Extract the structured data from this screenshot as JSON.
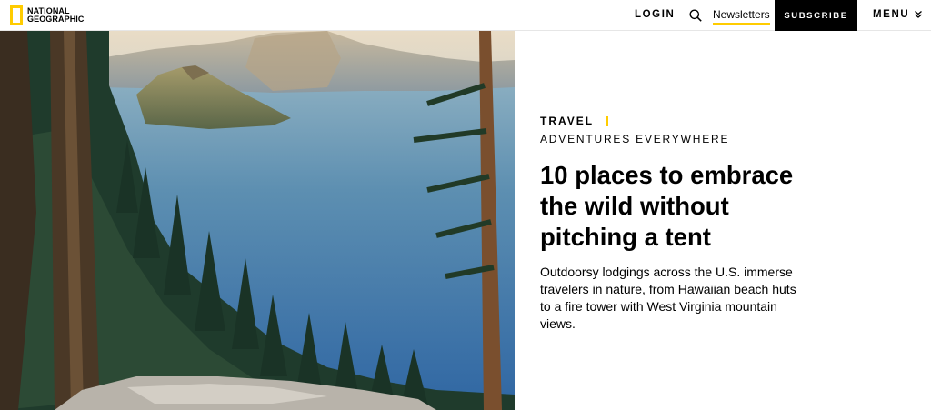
{
  "header": {
    "logo_line1": "NATIONAL",
    "logo_line2": "GEOGRAPHIC",
    "login_label": "LOGIN",
    "newsletters_label": "Newsletters",
    "subscribe_label": "SUBSCRIBE",
    "menu_label": "MENU",
    "icons": {
      "search": "search-icon",
      "menu": "chevron-down-icon"
    },
    "colors": {
      "brand_yellow": "#ffcc00",
      "subscribe_bg": "#000000"
    }
  },
  "article": {
    "section": "TRAVEL",
    "series": "ADVENTURES EVERYWHERE",
    "headline": "10 places to embrace the wild without pitching a tent",
    "dek": "Outdoorsy lodgings across the U.S. immerse travelers in nature, from Hawaiian beach huts to a fire tower with West Virginia mountain views."
  }
}
